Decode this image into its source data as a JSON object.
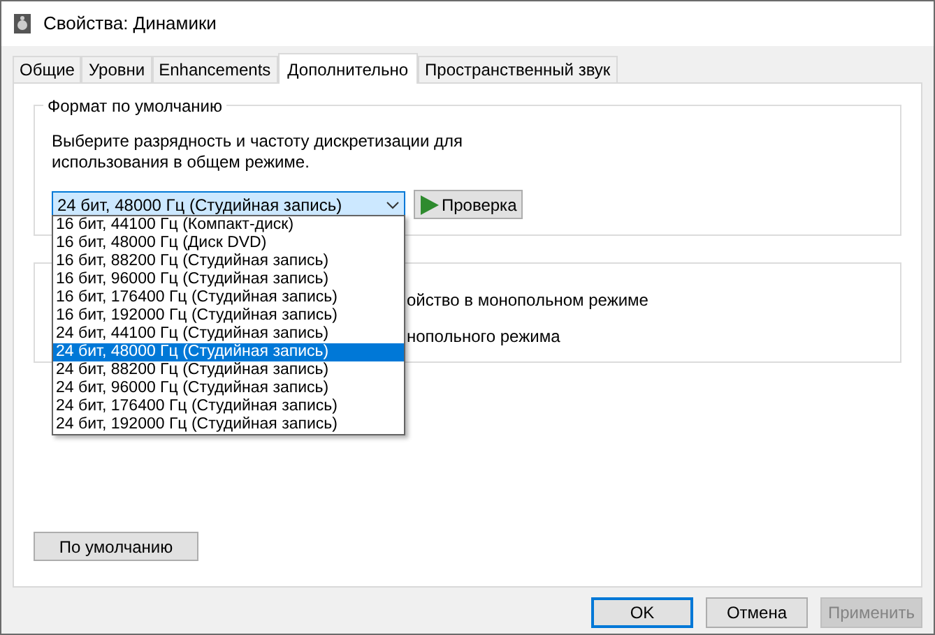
{
  "window": {
    "title": "Свойства: Динамики"
  },
  "tabs": [
    {
      "label": "Общие",
      "selected": false
    },
    {
      "label": "Уровни",
      "selected": false
    },
    {
      "label": "Enhancements",
      "selected": false
    },
    {
      "label": "Дополнительно",
      "selected": true
    },
    {
      "label": "Пространственный звук",
      "selected": false
    }
  ],
  "default_format": {
    "title": "Формат по умолчанию",
    "description": "Выберите разрядность и частоту дискретизации для использования в общем режиме.",
    "combo_value": "24 бит, 48000 Гц (Студийная запись)",
    "test_button": "Проверка",
    "options": [
      {
        "label": "16 бит, 44100 Гц (Компакт-диск)",
        "selected": false
      },
      {
        "label": "16 бит, 48000 Гц (Диск DVD)",
        "selected": false
      },
      {
        "label": "16 бит, 88200 Гц (Студийная запись)",
        "selected": false
      },
      {
        "label": "16 бит, 96000 Гц (Студийная запись)",
        "selected": false
      },
      {
        "label": "16 бит, 176400 Гц (Студийная запись)",
        "selected": false
      },
      {
        "label": "16 бит, 192000 Гц (Студийная запись)",
        "selected": false
      },
      {
        "label": "24 бит, 44100 Гц (Студийная запись)",
        "selected": false
      },
      {
        "label": "24 бит, 48000 Гц (Студийная запись)",
        "selected": true
      },
      {
        "label": "24 бит, 88200 Гц (Студийная запись)",
        "selected": false
      },
      {
        "label": "24 бит, 96000 Гц (Студийная запись)",
        "selected": false
      },
      {
        "label": "24 бит, 176400 Гц (Студийная запись)",
        "selected": false
      },
      {
        "label": "24 бит, 192000 Гц (Студийная запись)",
        "selected": false
      }
    ]
  },
  "exclusive_mode": {
    "lines": [
      "ойство в монопольном режиме",
      "нопольного режима"
    ]
  },
  "restore_button": "По умолчанию",
  "buttons": [
    {
      "label": "OK",
      "kind": "default",
      "disabled": false
    },
    {
      "label": "Отмена",
      "kind": "normal",
      "disabled": false
    },
    {
      "label": "Применить",
      "kind": "normal",
      "disabled": true
    }
  ]
}
